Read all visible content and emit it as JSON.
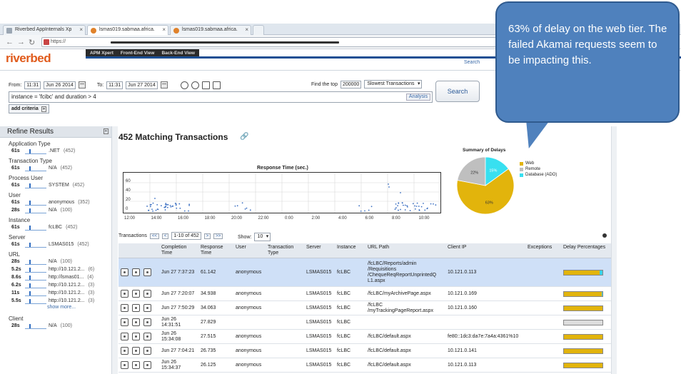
{
  "browser": {
    "tabs": [
      {
        "label": "Riverbed AppInternals Xp",
        "active": false
      },
      {
        "label": "lsmas019.sabmaa.africa.",
        "active": true
      },
      {
        "label": "lsmas019.sabmaa.africa.",
        "active": false
      }
    ],
    "url": "https://"
  },
  "app": {
    "logo": "riverbed",
    "nav": [
      "APM Xpert",
      "Front-End View",
      "Back-End View"
    ],
    "search_link": "Search"
  },
  "filters": {
    "from_label": "From:",
    "from_time": "11:31",
    "from_date": "Jun 26 2014",
    "to_label": "To:",
    "to_time": "11:31",
    "to_date": "Jun 27 2014",
    "top_label": "Find the top",
    "top_value": "200000",
    "sort": "Slowest Transactions",
    "query": "instance = 'fcibc' and duration > 4",
    "analysis": "Analysis",
    "search_button": "Search",
    "add_criteria": "add criteria"
  },
  "callout": "63% of delay on the web tier. The failed Akamai requests seem to be impacting this.",
  "refine": {
    "title": "Refine Results",
    "groups": [
      {
        "title": "Application Type",
        "rows": [
          {
            "dur": "61s",
            "value": ".NET",
            "count": "(452)"
          }
        ]
      },
      {
        "title": "Transaction Type",
        "rows": [
          {
            "dur": "61s",
            "value": "N/A",
            "count": "(452)"
          }
        ]
      },
      {
        "title": "Process User",
        "rows": [
          {
            "dur": "61s",
            "value": "SYSTEM",
            "count": "(452)"
          }
        ]
      },
      {
        "title": "User",
        "rows": [
          {
            "dur": "61s",
            "value": "anonymous",
            "count": "(352)"
          },
          {
            "dur": "28s",
            "value": "N/A",
            "count": "(100)"
          }
        ]
      },
      {
        "title": "Instance",
        "rows": [
          {
            "dur": "61s",
            "value": "fcLBC",
            "count": "(452)"
          }
        ]
      },
      {
        "title": "Server",
        "rows": [
          {
            "dur": "61s",
            "value": "LSMAS015",
            "count": "(452)"
          }
        ]
      },
      {
        "title": "URL",
        "rows": [
          {
            "dur": "28s",
            "value": "N/A",
            "count": "(100)"
          },
          {
            "dur": "5.2s",
            "value": "http://10.121.2...",
            "count": "(6)"
          },
          {
            "dur": "8.6s",
            "value": "http://lsmas01...",
            "count": "(4)"
          },
          {
            "dur": "6.2s",
            "value": "http://10.121.2...",
            "count": "(3)"
          },
          {
            "dur": "11s",
            "value": "http://10.121.2...",
            "count": "(3)"
          },
          {
            "dur": "5.5s",
            "value": "http://10.121.2...",
            "count": "(3)"
          }
        ],
        "more": "show more..."
      },
      {
        "title": "Client",
        "rows": [
          {
            "dur": "28s",
            "value": "N/A",
            "count": "(100)"
          }
        ]
      }
    ]
  },
  "main": {
    "title": "452 Matching Transactions",
    "response_chart_title": "Response Time (sec.)",
    "response_y_ticks": [
      "60",
      "40",
      "20",
      "0"
    ],
    "response_x_ticks": [
      "12:00",
      "14:00",
      "16:00",
      "18:00",
      "20:00",
      "22:00",
      "0:00",
      "2:00",
      "4:00",
      "6:00",
      "8:00",
      "10:00"
    ],
    "delay_title": "Summary of Delays",
    "delay_labels": [
      "63%",
      "22%",
      "15%"
    ],
    "transactions_label": "Transactions",
    "pager_first": "<<",
    "pager_prev": "<",
    "pager_range": "1-10 of 452",
    "pager_next": ">",
    "pager_last": ">>",
    "show_label": "Show:",
    "show_value": "10"
  },
  "chart_data": {
    "type": "pie",
    "title": "Summary of Delays",
    "categories": [
      "Web",
      "Remote",
      "Database (ADO)"
    ],
    "values": [
      63,
      22,
      15
    ],
    "colors": [
      "#e2b40c",
      "#bfbfbf",
      "#38e0f0"
    ],
    "legend": "right"
  },
  "table": {
    "headers": [
      "",
      "Completion Time",
      "Response Time",
      "User",
      "Transaction Type",
      "Server",
      "Instance",
      "URL Path",
      "Client IP",
      "Exceptions",
      "Delay Percentages"
    ],
    "rows": [
      {
        "time": "Jun 27 7:37:23",
        "resp": "61.142",
        "user": "anonymous",
        "type": "",
        "server": "LSMAS015",
        "inst": "fcLBC",
        "url": "/fcLBC/Reports/admin /Requisitions /ChequeReqReportUnprintedQ L1.aspx",
        "ip": "10.121.0.113",
        "exc": "",
        "web": 0.92,
        "db": 0.08
      },
      {
        "time": "Jun 27 7:20:07",
        "resp": "34.938",
        "user": "anonymous",
        "type": "",
        "server": "LSMAS015",
        "inst": "fcLBC",
        "url": "/fcLBC/myArchivePage.aspx",
        "ip": "10.121.0.169",
        "exc": "",
        "web": 0.98,
        "db": 0.02
      },
      {
        "time": "Jun 27 7:50:29",
        "resp": "34.063",
        "user": "anonymous",
        "type": "",
        "server": "LSMAS015",
        "inst": "fcLBC",
        "url": "/fcLBC /myTrackingPageReport.aspx",
        "ip": "10.121.0.160",
        "exc": "",
        "web": 1.0,
        "db": 0
      },
      {
        "time": "Jun 26 14:31:51",
        "resp": "27.829",
        "user": "",
        "type": "",
        "server": "LSMAS015",
        "inst": "fcLBC",
        "url": "",
        "ip": "",
        "exc": "",
        "web": 0,
        "db": 0
      },
      {
        "time": "Jun 26 15:34:08",
        "resp": "27.515",
        "user": "anonymous",
        "type": "",
        "server": "LSMAS015",
        "inst": "fcLBC",
        "url": "/fcLBC/default.aspx",
        "ip": "fe80::1dc3:da7e:7a4a:4361%10",
        "exc": "",
        "web": 1.0,
        "db": 0
      },
      {
        "time": "Jun 27 7:04:21",
        "resp": "26.735",
        "user": "anonymous",
        "type": "",
        "server": "LSMAS015",
        "inst": "fcLBC",
        "url": "/fcLBC/default.aspx",
        "ip": "10.121.0.141",
        "exc": "",
        "web": 1.0,
        "db": 0
      },
      {
        "time": "Jun 26 15:34:37",
        "resp": "26.125",
        "user": "anonymous",
        "type": "",
        "server": "LSMAS015",
        "inst": "fcLBC",
        "url": "/fcLBC/default.aspx",
        "ip": "10.121.0.113",
        "exc": "",
        "web": 1.0,
        "db": 0
      }
    ]
  }
}
